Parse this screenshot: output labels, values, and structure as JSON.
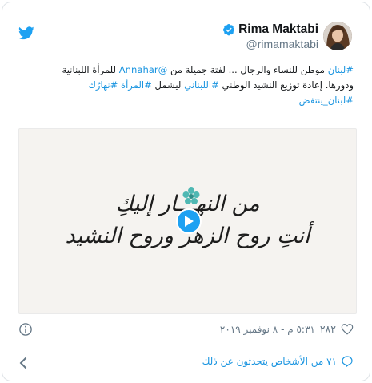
{
  "author": {
    "name": "Rima Maktabi",
    "handle": "@rimamaktabi",
    "verified": true
  },
  "tweet": {
    "line1": [
      {
        "text": "#لبنان",
        "link": true
      },
      {
        "text": " موطن للنساء والرجال ... لفتة جميلة من ",
        "link": false
      },
      {
        "text": "@Annahar",
        "link": true
      },
      {
        "text": " للمرأة اللبنانية",
        "link": false
      }
    ],
    "line2": [
      {
        "text": "ودورها. إعادة توزيع النشيد الوطني ",
        "link": false
      },
      {
        "text": "#اللبناني",
        "link": true
      },
      {
        "text": " ليشمل ",
        "link": false
      },
      {
        "text": "#المرأة",
        "link": true
      },
      {
        "text": " ",
        "link": false
      },
      {
        "text": "#نهارُك",
        "link": true
      }
    ],
    "line3": [
      {
        "text": "#لبنان_ينتفض",
        "link": true
      }
    ]
  },
  "media": {
    "line1": "من النهـــار إليكِ",
    "line2": "أنتِ روح الزهر وروح النشيد",
    "has_video": true
  },
  "meta": {
    "timestamp": "٥:٣١ م - ٨ نوفمبر ٢٠١٩",
    "likes": "٢٨٢"
  },
  "footer": {
    "conversation": "٧١ من الأشخاص يتحدثون عن ذلك"
  },
  "icons": {
    "twitter": "twitter-bird-icon",
    "verified": "verified-badge-icon",
    "info": "info-icon",
    "heart": "heart-icon",
    "reply": "reply-icon",
    "chevron": "chevron-left-icon"
  },
  "colors": {
    "link": "#1b95e0",
    "brand": "#1da1f2",
    "muted": "#657786",
    "text": "#14171a"
  }
}
